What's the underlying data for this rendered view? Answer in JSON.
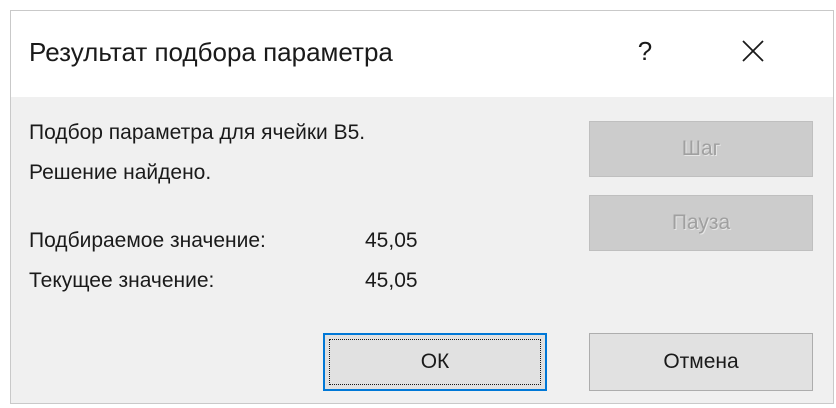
{
  "dialog": {
    "title": "Результат подбора параметра",
    "help_label": "?",
    "close_icon": "close-icon"
  },
  "message": {
    "line1": "Подбор параметра для ячейки B5.",
    "line2": "Решение найдено."
  },
  "results": {
    "target_label": "Подбираемое значение:",
    "target_value": "45,05",
    "current_label": "Текущее значение:",
    "current_value": "45,05"
  },
  "buttons": {
    "step_label": "Шаг",
    "pause_label": "Пауза",
    "ok_label": "ОК",
    "cancel_label": "Отмена"
  },
  "colors": {
    "dialog_bg": "#f0f0f0",
    "focus_border": "#0078d7",
    "disabled_bg": "#cccccc"
  }
}
